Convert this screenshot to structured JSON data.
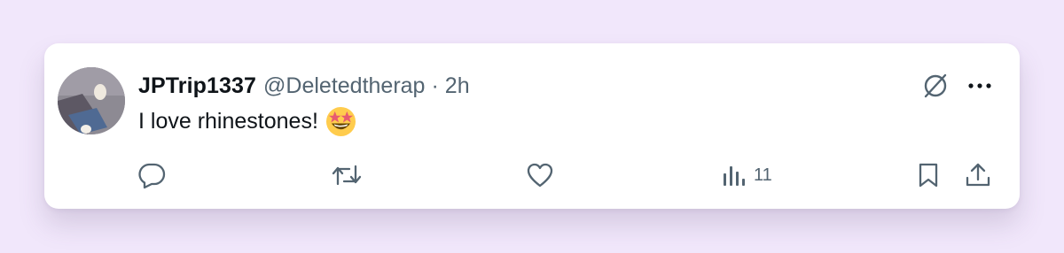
{
  "post": {
    "display_name": "JPTrip1337",
    "handle": "@Deletedtherap",
    "separator": "·",
    "time": "2h",
    "text": "I love rhinestones!",
    "emoji": "star-struck"
  },
  "actions": {
    "reply_icon": "speech-bubble-icon",
    "repost_icon": "repost-arrows-icon",
    "like_icon": "heart-icon",
    "views_icon": "bar-chart-icon",
    "views_count": "11",
    "bookmark_icon": "bookmark-icon",
    "share_icon": "share-upload-icon"
  },
  "top_icons": {
    "grok": "grok-icon",
    "more": "more-dots-icon"
  },
  "colors": {
    "page_background": "#f1e7fb",
    "card_background": "#ffffff",
    "primary_text": "#0f1419",
    "secondary_text": "#536471"
  }
}
